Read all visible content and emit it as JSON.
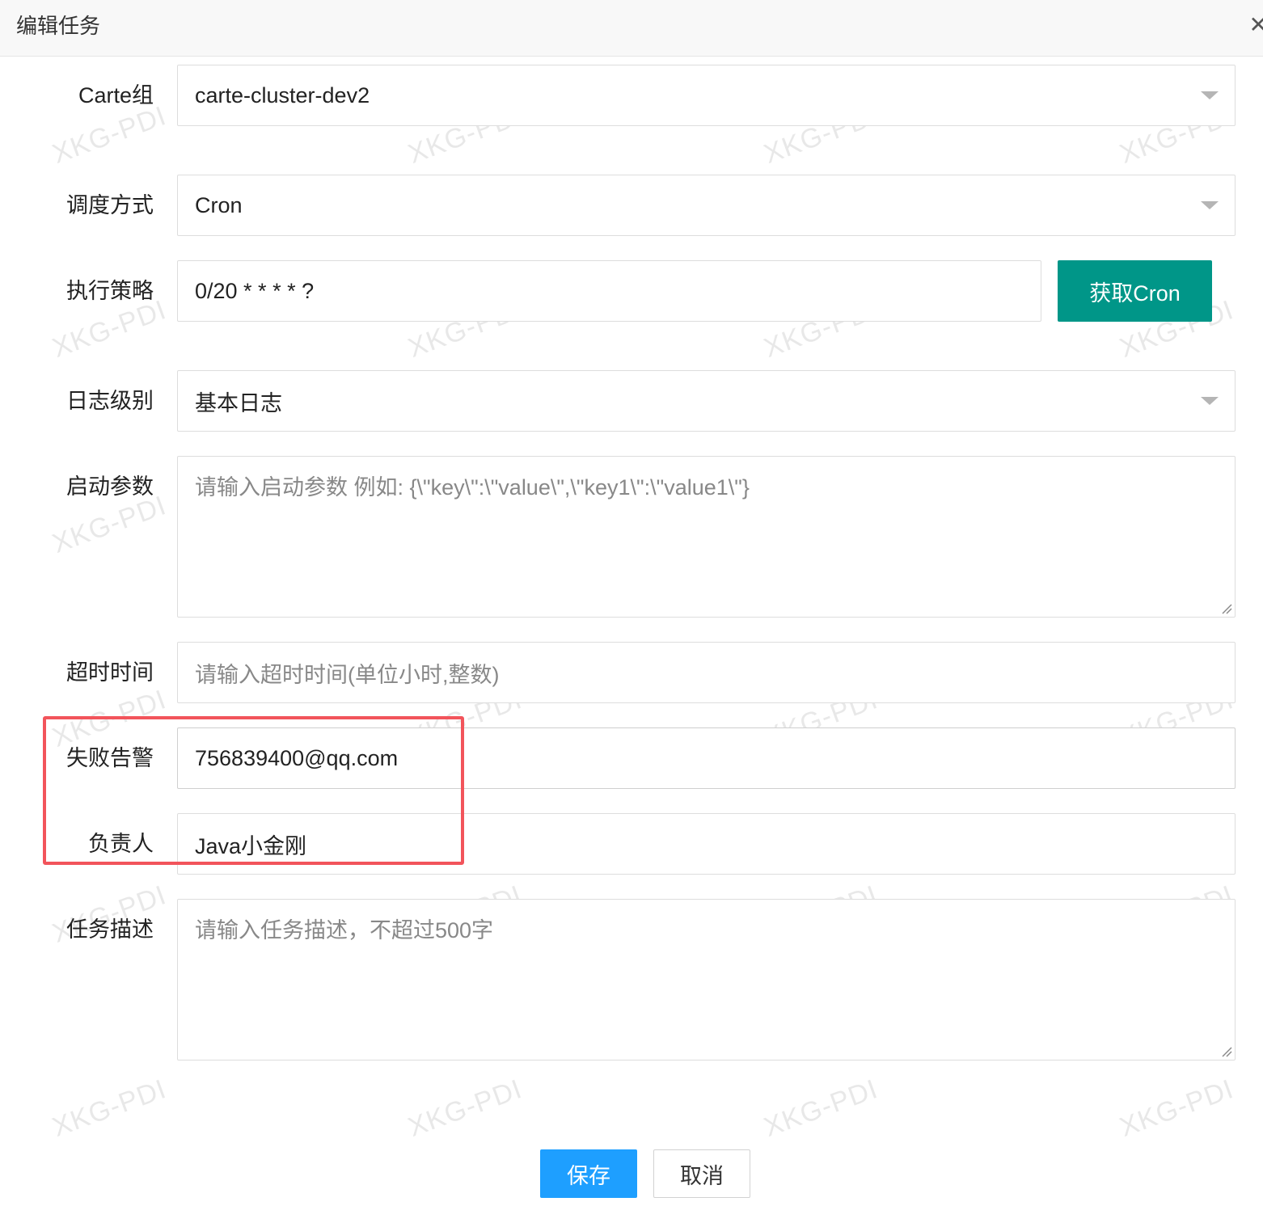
{
  "dialog": {
    "title": "编辑任务",
    "close_icon": "close-icon"
  },
  "form": {
    "carte_group": {
      "label": "Carte组",
      "value": "carte-cluster-dev2"
    },
    "schedule_mode": {
      "label": "调度方式",
      "value": "Cron"
    },
    "strategy": {
      "label": "执行策略",
      "value": "0/20 * * * * ?",
      "button": "获取Cron"
    },
    "log_level": {
      "label": "日志级别",
      "value": "基本日志"
    },
    "start_params": {
      "label": "启动参数",
      "placeholder": "请输入启动参数 例如: {\\\"key\\\":\\\"value\\\",\\\"key1\\\":\\\"value1\\\"}"
    },
    "timeout": {
      "label": "超时时间",
      "placeholder": "请输入超时时间(单位小时,整数)"
    },
    "fail_alert": {
      "label": "失败告警",
      "value": "756839400@qq.com"
    },
    "owner": {
      "label": "负责人",
      "value": "Java小金刚"
    },
    "description": {
      "label": "任务描述",
      "placeholder": "请输入任务描述，不超过500字"
    }
  },
  "actions": {
    "save": "保存",
    "cancel": "取消"
  },
  "watermark": "XKG-PDI",
  "colors": {
    "primary_button": "#1e9fff",
    "cron_button": "#009688",
    "highlight_border": "#f2545b"
  }
}
